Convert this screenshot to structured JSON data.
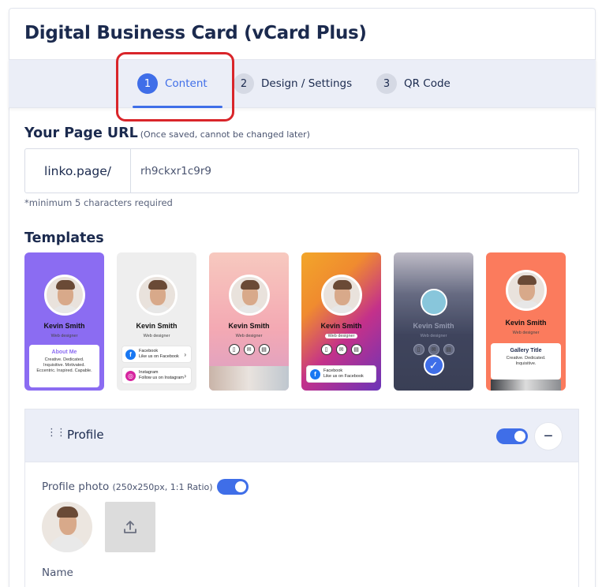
{
  "page": {
    "title": "Digital Business Card (vCard Plus)"
  },
  "steps": [
    {
      "number": "1",
      "label": "Content",
      "active": true
    },
    {
      "number": "2",
      "label": "Design / Settings",
      "active": false
    },
    {
      "number": "3",
      "label": "QR Code",
      "active": false
    }
  ],
  "url_section": {
    "title": "Your Page URL",
    "note": "(Once saved, cannot be changed later)",
    "prefix": "linko.page/",
    "value": "rh9ckxr1c9r9",
    "hint": "*minimum 5 characters required"
  },
  "templates": {
    "title": "Templates",
    "items": [
      {
        "name": "Kevin Smith",
        "role": "Web designer",
        "panel_title": "About Me",
        "panel_text": "Creative. Dedicated. Inquisitive. Motivated. Eccentric. Inspired. Capable."
      },
      {
        "name": "Kevin Smith",
        "role": "Web designer",
        "row1_title": "Facebook",
        "row1_sub": "Like us on Facebook",
        "row2_title": "Instagram",
        "row2_sub": "Follow us on Instagram"
      },
      {
        "name": "Kevin Smith",
        "role": "Web designer"
      },
      {
        "name": "Kevin Smith",
        "role": "Web designer",
        "row1_title": "Facebook",
        "row1_sub": "Like us on Facebook"
      },
      {
        "name": "Kevin Smith",
        "role": "Web designer",
        "selected": true
      },
      {
        "name": "Kevin Smith",
        "role": "Web designer",
        "panel_title": "Gallery Title",
        "panel_text": "Creative. Dedicated. Inquisitive."
      }
    ]
  },
  "profile": {
    "title": "Profile",
    "enabled": true,
    "photo_label": "Profile photo",
    "photo_note": "(250x250px, 1:1 Ratio)",
    "photo_enabled": true,
    "name_label": "Name"
  },
  "colors": {
    "accent": "#3f6ee8",
    "highlight": "#d9252a",
    "header_bg": "#ebeef7"
  }
}
